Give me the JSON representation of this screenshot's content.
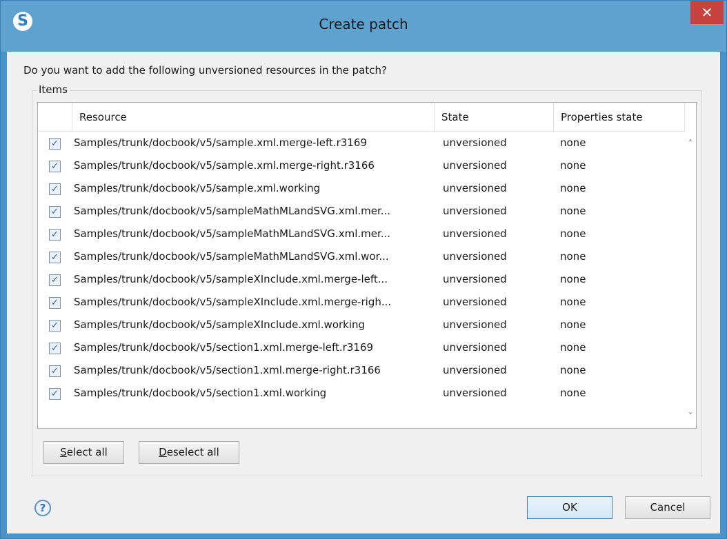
{
  "window": {
    "title": "Create patch",
    "app_icon_glyph": "S",
    "close_glyph": "✕"
  },
  "dialog": {
    "prompt": "Do you want to add the following unversioned resources in the patch?",
    "group_title": "Items",
    "columns": {
      "resource": "Resource",
      "state": "State",
      "properties_state": "Properties state"
    },
    "rows": [
      {
        "checked": true,
        "resource": "Samples/trunk/docbook/v5/sample.xml.merge-left.r3169",
        "state": "unversioned",
        "props": "none"
      },
      {
        "checked": true,
        "resource": "Samples/trunk/docbook/v5/sample.xml.merge-right.r3166",
        "state": "unversioned",
        "props": "none"
      },
      {
        "checked": true,
        "resource": "Samples/trunk/docbook/v5/sample.xml.working",
        "state": "unversioned",
        "props": "none"
      },
      {
        "checked": true,
        "resource": "Samples/trunk/docbook/v5/sampleMathMLandSVG.xml.mer...",
        "state": "unversioned",
        "props": "none"
      },
      {
        "checked": true,
        "resource": "Samples/trunk/docbook/v5/sampleMathMLandSVG.xml.mer...",
        "state": "unversioned",
        "props": "none"
      },
      {
        "checked": true,
        "resource": "Samples/trunk/docbook/v5/sampleMathMLandSVG.xml.wor...",
        "state": "unversioned",
        "props": "none"
      },
      {
        "checked": true,
        "resource": "Samples/trunk/docbook/v5/sampleXInclude.xml.merge-left...",
        "state": "unversioned",
        "props": "none"
      },
      {
        "checked": true,
        "resource": "Samples/trunk/docbook/v5/sampleXInclude.xml.merge-righ...",
        "state": "unversioned",
        "props": "none"
      },
      {
        "checked": true,
        "resource": "Samples/trunk/docbook/v5/sampleXInclude.xml.working",
        "state": "unversioned",
        "props": "none"
      },
      {
        "checked": true,
        "resource": "Samples/trunk/docbook/v5/section1.xml.merge-left.r3169",
        "state": "unversioned",
        "props": "none"
      },
      {
        "checked": true,
        "resource": "Samples/trunk/docbook/v5/section1.xml.merge-right.r3166",
        "state": "unversioned",
        "props": "none"
      },
      {
        "checked": true,
        "resource": "Samples/trunk/docbook/v5/section1.xml.working",
        "state": "unversioned",
        "props": "none"
      }
    ],
    "buttons": {
      "select_all": {
        "first": "S",
        "rest": "elect all"
      },
      "deselect_all": {
        "first": "D",
        "rest": "eselect all"
      },
      "ok": "OK",
      "cancel": "Cancel"
    },
    "help_glyph": "?",
    "scroll_up_glyph": "˄",
    "scroll_down_glyph": "˅"
  },
  "colors": {
    "titlebar": "#5ea2d0",
    "close_button": "#c8423f",
    "dialog_bg": "#f0f0f0"
  },
  "icons": [
    "s-logo-icon",
    "close-icon",
    "checkbox-checked-icon",
    "help-icon",
    "chevron-up-icon",
    "chevron-down-icon"
  ]
}
